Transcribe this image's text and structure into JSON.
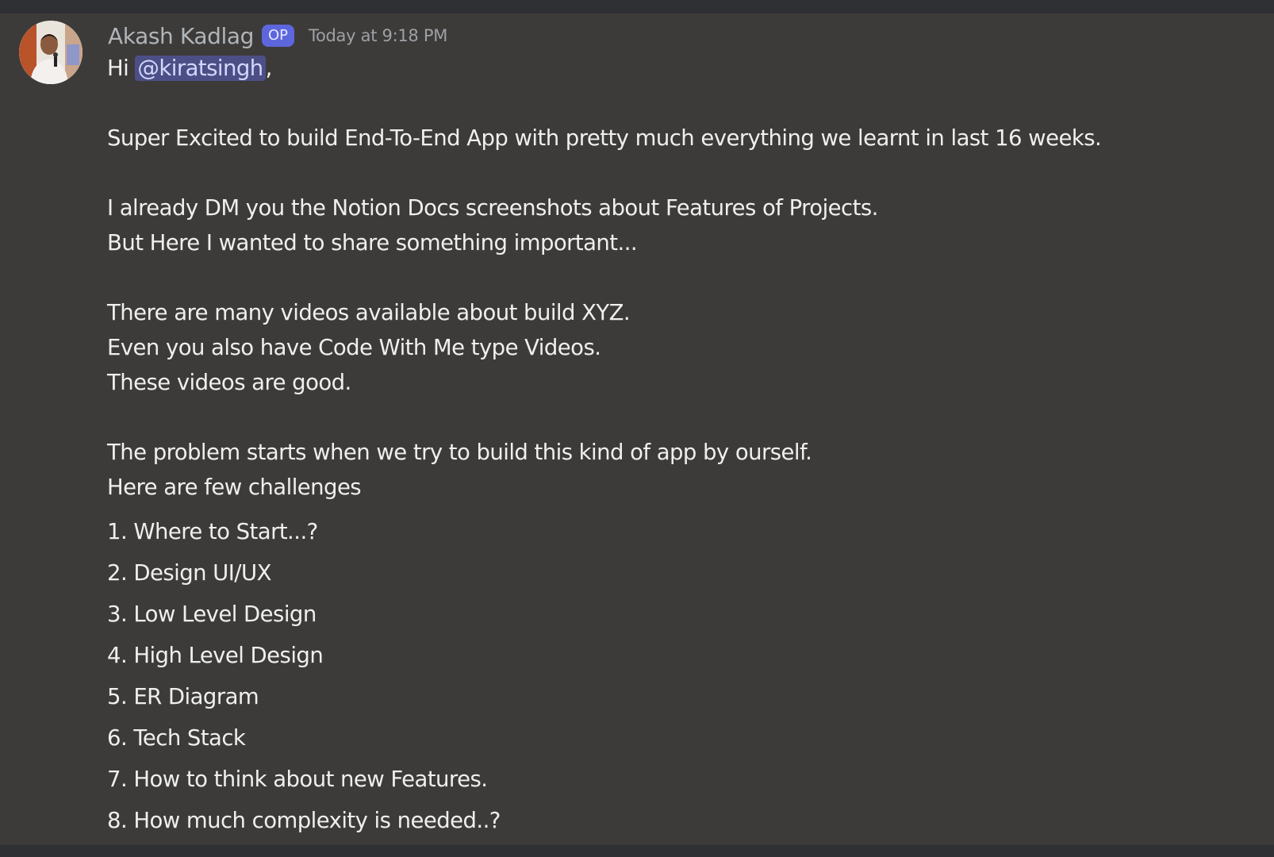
{
  "message": {
    "author": "Akash Kadlag",
    "badge": "OP",
    "timestamp": "Today at 9:18 PM",
    "greeting_prefix": "Hi ",
    "mention": "@kiratsingh",
    "greeting_suffix": ",",
    "paragraphs": {
      "p1": "Super Excited to build End-To-End App with pretty much everything we learnt in last 16 weeks.",
      "p2_line1": "I already DM you the Notion Docs screenshots about Features of Projects.",
      "p2_line2": "But Here I wanted to share something important...",
      "p3_line1": "There are many videos available about build XYZ.",
      "p3_line2": "Even you also have Code With Me type Videos.",
      "p3_line3": "These videos are good.",
      "p4_line1": "The problem starts when we try to build this kind of app by ourself.",
      "p4_line2": "Here are few challenges"
    },
    "challenges": [
      "1. Where to Start...?",
      "2. Design UI/UX",
      "3. Low Level Design",
      "4. High Level Design",
      "5. ER Diagram",
      "6. Tech Stack",
      "7. How to think about new Features.",
      "8. How much complexity is needed..?"
    ]
  },
  "colors": {
    "background": "#3c3b39",
    "author": "#b1b4b8",
    "badge": "#5e66de",
    "mention_bg": "#4c4f86",
    "text": "#efefee"
  }
}
